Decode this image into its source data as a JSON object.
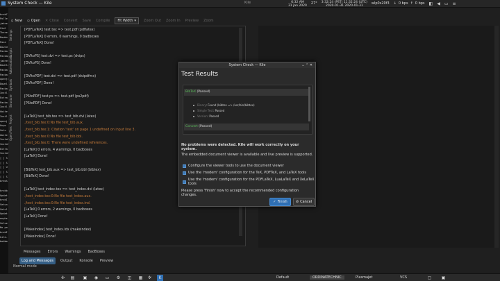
{
  "topbar": {
    "title": "System Check — Kile",
    "status": {
      "time1": "6:32 AM",
      "date1": "31 jan 2020",
      "temp": "27°",
      "time2": "3:32:24 (PST) 11:32:24 (UTC)",
      "date2": "2020-01-31  2020-01-31",
      "host": "wlp0s20f3",
      "net_down": "0 bps",
      "net_up": "0 bps"
    }
  },
  "terminal": {
    "lines": [
      "",
      "brokC",
      "Polle",
      "jabre",
      "Xtml",
      "There",
      "Dowbn",
      "Pase",
      "Dowld",
      "Packa",
      "Packag",
      "jabref",
      "Downlo",
      "Packa",
      "Packa",
      "openjd",
      "Downl",
      "Packa",
      "Instl",
      "Extra",
      "Packa",
      "Instl",
      "kbite",
      "Instl",
      "openj",
      "Unpo",
      "Setu",
      "kbite",
      "Instal",
      "Instal",
      "Extra",
      "Instal",
      "[ ] S",
      "[ ] S",
      "[ ] U",
      "[ ] S",
      "[ ] S",
      "breoS",
      "",
      "brokb",
      "Updat",
      "brokI",
      "Setun",
      "Setul",
      "Updat",
      "enphs",
      "Selue",
      "No pa",
      "brokI",
      "kile-",
      "bokbm",
      ""
    ]
  },
  "kile": {
    "window_title": "Kile",
    "toolbar": [
      "New",
      "Open",
      "Close",
      "Convert",
      "Save",
      "Compile",
      "Fit Width",
      "Zoom Out",
      "Zoom In",
      "Preview",
      "Zoom"
    ],
    "side_tabs": [
      "Open Files",
      "Project",
      "Structure",
      "Symbols",
      "Abbreviations",
      "Scripts",
      "Settings"
    ],
    "log_lines": [
      {
        "text": "[PDFLaTeX] test.tex => test.pdf (pdflatex)",
        "c": "n"
      },
      {
        "text": "[PDFLaTeX] 0 errors, 0 warnings, 0 badboxes",
        "c": "n"
      },
      {
        "text": "[PDFLaTeX] Done!",
        "c": "n"
      },
      {
        "text": "",
        "c": "n"
      },
      {
        "text": "[DVItoPS] test.dvi => test.ps (dvips)",
        "c": "n"
      },
      {
        "text": "[DVItoPS] Done!",
        "c": "n"
      },
      {
        "text": "",
        "c": "n"
      },
      {
        "text": "[DVItoPDF] test.dvi => test.pdf (dvipdfmx)",
        "c": "n"
      },
      {
        "text": "[DVItoPDF] Done!",
        "c": "n"
      },
      {
        "text": "",
        "c": "n"
      },
      {
        "text": "[PStoPDF] test.ps => test.pdf (ps2pdf)",
        "c": "n"
      },
      {
        "text": "[PStoPDF] Done!",
        "c": "n"
      },
      {
        "text": "",
        "c": "n"
      },
      {
        "text": "[LaTeX] test_bib.tex => test_bib.dvi (latex)",
        "c": "n"
      },
      {
        "text": "./test_bib.tex:0:No file test_bib.aux.",
        "c": "w"
      },
      {
        "text": "./test_bib.tex:1: Citation 'test' on page 1 undefined on input line 3.",
        "c": "w"
      },
      {
        "text": "./test_bib.tex:0:No file test_bib.bbl.",
        "c": "w"
      },
      {
        "text": "./test_bib.tex:0: There were undefined references.",
        "c": "w"
      },
      {
        "text": "[LaTeX] 0 errors, 4 warnings, 0 badboxes",
        "c": "n"
      },
      {
        "text": "[LaTeX] Done!",
        "c": "n"
      },
      {
        "text": "",
        "c": "n"
      },
      {
        "text": "[BibTeX] test_bib.aux => test_bib.bbl (bibtex)",
        "c": "n"
      },
      {
        "text": "[BibTeX] Done!",
        "c": "n"
      },
      {
        "text": "",
        "c": "n"
      },
      {
        "text": "[LaTeX] test_index.tex => test_index.dvi (latex)",
        "c": "n"
      },
      {
        "text": "./test_index.tex:0:No file test_index.aux.",
        "c": "w"
      },
      {
        "text": "./test_index.tex:0:No file test_index.ind.",
        "c": "w"
      },
      {
        "text": "[LaTeX] 0 errors, 2 warnings, 0 badboxes",
        "c": "n"
      },
      {
        "text": "[LaTeX] Done!",
        "c": "n"
      },
      {
        "text": "",
        "c": "n"
      },
      {
        "text": "[MakeIndex] test_index.idx (makeindex)",
        "c": "n"
      },
      {
        "text": "[MakeIndex] Done!",
        "c": "n"
      }
    ],
    "msg_tabs": [
      "Messages",
      "Errors",
      "Warnings",
      "BadBoxes"
    ],
    "bottom_tabs": [
      "Log and Messages",
      "Output",
      "Konsole",
      "Preview"
    ],
    "status": "Normal mode"
  },
  "dialog": {
    "window_title": "System Check — Kile",
    "heading": "Test Results",
    "bibtex_label": "BibTeX",
    "bibtex_status": "(Passed)",
    "items": [
      {
        "name": "Binary",
        "result": "Found (bibtex => /usr/bin/bibtex)"
      },
      {
        "name": "Simple Test",
        "result": "Passed"
      },
      {
        "name": "Version",
        "result": "Passed"
      }
    ],
    "convert_label": "Convert",
    "convert_status": "(Passed)",
    "no_problems": "No problems were detected. Kile will work correctly on your system.",
    "viewer_msg": "The embedded document viewer is available and live preview is supported.",
    "checks": [
      "Configure the viewer tools to use the document viewer",
      "Use the 'modern' configuration for the TeX, PDFTeX, and LaTeX tools",
      "Use the 'modern' configuration for the PDFLaTeX, LuaLaTeX and XeLaTeX tools"
    ],
    "press_finish": "Please press 'Finish' now to accept the recommended configuration changes.",
    "finish_label": "Finish",
    "cancel_label": "Cancel"
  },
  "taskbar": {
    "workspaces": [
      "Default",
      "ORDINATECHNIC",
      "Plasmajet",
      "VCS"
    ]
  },
  "colors": {
    "accent": "#2f6fb3",
    "passed": "#5bc05b",
    "warning": "#c47a3a"
  }
}
